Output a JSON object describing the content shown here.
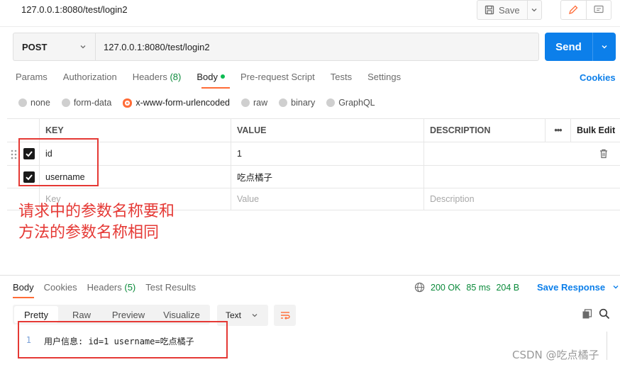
{
  "request": {
    "title": "127.0.0.1:8080/test/login2",
    "save_label": "Save",
    "method": "POST",
    "url": "127.0.0.1:8080/test/login2",
    "send_label": "Send"
  },
  "tabs": [
    {
      "label": "Params"
    },
    {
      "label": "Authorization"
    },
    {
      "label": "Headers",
      "count": "(8)"
    },
    {
      "label": "Body"
    },
    {
      "label": "Pre-request Script"
    },
    {
      "label": "Tests"
    },
    {
      "label": "Settings"
    }
  ],
  "cookies_label": "Cookies",
  "body_types": [
    "none",
    "form-data",
    "x-www-form-urlencoded",
    "raw",
    "binary",
    "GraphQL"
  ],
  "body_type_selected": "x-www-form-urlencoded",
  "table": {
    "headers": {
      "key": "KEY",
      "value": "VALUE",
      "description": "DESCRIPTION",
      "more": "•••",
      "bulk": "Bulk Edit"
    },
    "rows": [
      {
        "key": "id",
        "value": "1",
        "checked": true
      },
      {
        "key": "username",
        "value": "吃点橘子",
        "checked": true
      }
    ],
    "placeholder": {
      "key": "Key",
      "value": "Value",
      "description": "Description"
    }
  },
  "annotation": {
    "line1": "请求中的参数名称要和",
    "line2": "方法的参数名称相同",
    "color": "#e53935"
  },
  "response": {
    "tabs": [
      {
        "label": "Body"
      },
      {
        "label": "Cookies"
      },
      {
        "label": "Headers",
        "count": "(5)"
      },
      {
        "label": "Test Results"
      }
    ],
    "status": "200 OK",
    "time": "85 ms",
    "size": "204 B",
    "save_label": "Save Response",
    "formats": [
      "Pretty",
      "Raw",
      "Preview",
      "Visualize"
    ],
    "format_selected": "Pretty",
    "text_type": "Text",
    "lines": [
      {
        "num": "1",
        "text": "用户信息: id=1 username=吃点橘子"
      }
    ]
  },
  "watermark": "CSDN @吃点橘子",
  "colors": {
    "accent": "#0c7fea",
    "orange": "#ff6c37",
    "green": "#0a8a3a"
  }
}
